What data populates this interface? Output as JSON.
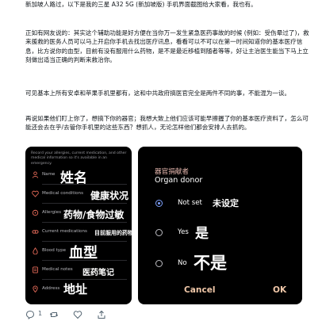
{
  "post": {
    "paragraphs": [
      "新加坡人路过，以下是我的三星 A32 5G (新加坡版) 手机界面截图给大家看，我也有。",
      "正如有网友说的：其实这个辅助功能是好方便在当你万一发生紧急医药事故的时候 (例如：受伤晕过了)，救来援救的医务人员可以马上开启你手机去找出医疗讯息，看看可以不可以在第一时间知道你的基本医疗信息，比方说你的血型，目前有没有服用什么药物，是不是最近移植到随者等等，好让主治医生能当下马上立刻做出适当正确的判断来救治你。",
      "可见基本上所有安卓和苹果手机里都有，这和中共政府搞医官完全是两件不同的事，不能混为一谈。",
      "再说如果他们盯上你了，想搞下你的器官；我想大致上他们应该可能早擦握了你的基本医疗资料了，怎么可能还会去在乎/去管你手机里的这些东西？想抓人，无论怎样他们都会安排人去抓的。"
    ]
  },
  "left_screen": {
    "intro": "Record your allergies, current medication, and other medical information so it's available in an emergency.",
    "rows": [
      {
        "icon": "person-icon",
        "en": "Name",
        "zh": "姓名",
        "zh_size": 17
      },
      {
        "icon": "heart-pulse-icon",
        "en": "Medical conditions",
        "zh": "健康状况",
        "zh_size": 12
      },
      {
        "icon": "allergy-icon",
        "en": "Allergies",
        "zh": "药物/食物过敏",
        "zh_size": 12
      },
      {
        "icon": "pill-icon",
        "en": "Current medications",
        "zh": "目前服用的药物",
        "zh_size": 7
      },
      {
        "icon": "blood-drop-icon",
        "en": "Blood type",
        "zh": "血型",
        "zh_size": 18
      },
      {
        "icon": "notes-icon",
        "en": "Medical notes",
        "zh": "医药笔记",
        "zh_size": 10
      },
      {
        "icon": "location-icon",
        "en": "Address",
        "zh": "地址",
        "zh_size": 15
      }
    ],
    "accent": "#e86c5a"
  },
  "right_screen": {
    "title_zh": "器官捐献者",
    "title_en": "Organ donor",
    "options": [
      {
        "en": "Not set",
        "zh": "未设定",
        "zh_size": 11,
        "selected": true
      },
      {
        "en": "Yes",
        "zh": "是",
        "zh_size": 17,
        "selected": false
      },
      {
        "en": "No",
        "zh": "不是",
        "zh_size": 21,
        "selected": false
      }
    ],
    "cancel_label": "Cancel",
    "ok_label": "OK"
  },
  "actions": {
    "reply_count": "1",
    "repost_count": "",
    "like_count": "",
    "icons": [
      "comment-icon",
      "repost-icon",
      "like-icon",
      "share-icon"
    ]
  }
}
